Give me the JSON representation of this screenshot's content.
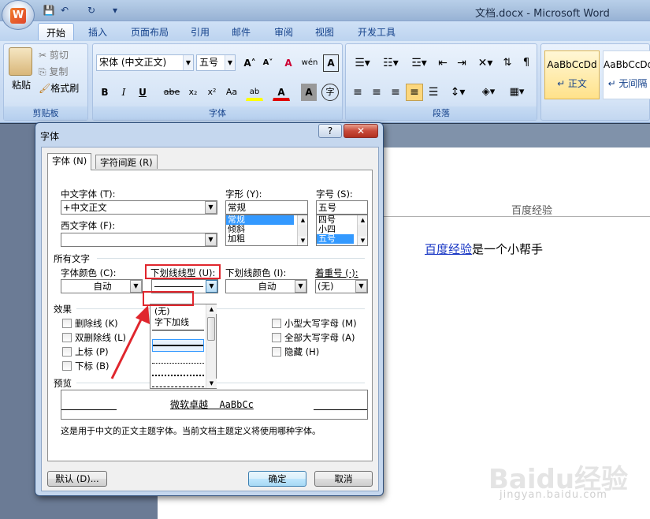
{
  "window": {
    "title": "文档.docx - Microsoft Word",
    "office_logo_letter": "W"
  },
  "qat": {
    "save": "💾",
    "undo": "↶",
    "redo": "↻",
    "more": "▾"
  },
  "ribbon_tabs": [
    "开始",
    "插入",
    "页面布局",
    "引用",
    "邮件",
    "审阅",
    "视图",
    "开发工具"
  ],
  "ribbon": {
    "clipboard": {
      "paste": "粘贴",
      "cut": "剪切",
      "copy": "复制",
      "format_painter": "格式刷",
      "label": "剪贴板"
    },
    "font": {
      "font_name": "宋体 (中文正文)",
      "font_size": "五号",
      "grow": "A˄",
      "shrink": "A˅",
      "clear": "A",
      "phonetic": "wén",
      "border": "A",
      "bold": "B",
      "italic": "I",
      "underline": "U",
      "strike": "abe",
      "sub": "x₂",
      "sup": "x²",
      "case": "Aa",
      "highlight": "ab",
      "color": "A",
      "shade": "A",
      "enclose": "字",
      "label": "字体"
    },
    "paragraph": {
      "label": "段落"
    },
    "styles": [
      {
        "sample": "AaBbCcDd",
        "name": "↵ 正文"
      },
      {
        "sample": "AaBbCcDd",
        "name": "↵ 无间隔"
      }
    ]
  },
  "document": {
    "header_text": "百度经验",
    "line_link": "百度经验",
    "line_rest": "是一个小帮手"
  },
  "dialog": {
    "title": "字体",
    "help": "?",
    "close": "✕",
    "tabs": [
      "字体 (N)",
      "字符间距 (R)"
    ],
    "cn_font_label": "中文字体 (T):",
    "cn_font_value": "+中文正文",
    "west_font_label": "西文字体 (F):",
    "west_font_value": "",
    "style_label": "字形 (Y):",
    "style_value": "常规",
    "style_options": [
      "常规",
      "倾斜",
      "加粗"
    ],
    "size_label": "字号 (S):",
    "size_value": "五号",
    "size_options": [
      "四号",
      "小四",
      "五号"
    ],
    "all_text_label": "所有文字",
    "font_color_label": "字体颜色 (C):",
    "font_color_value": "自动",
    "underline_type_label": "下划线线型 (U):",
    "underline_color_label": "下划线颜色 (I):",
    "underline_color_value": "自动",
    "emphasis_label": "着重号 (·):",
    "emphasis_value": "(无)",
    "effects_label": "效果",
    "effects_left": [
      "删除线 (K)",
      "双删除线 (L)",
      "上标 (P)",
      "下标 (B)"
    ],
    "effects_right": [
      "小型大写字母 (M)",
      "全部大写字母 (A)",
      "隐藏 (H)"
    ],
    "underline_options": [
      "(无)",
      "字下加线"
    ],
    "preview_label": "预览",
    "preview_text": "微软卓越  AaBbCc",
    "desc": "这是用于中文的正文主题字体。当前文档主题定义将使用哪种字体。",
    "default_btn": "默认 (D)...",
    "ok_btn": "确定",
    "cancel_btn": "取消"
  },
  "watermark": {
    "brand": "Baidu经验",
    "url": "jingyan.baidu.com"
  },
  "colors": {
    "accent": "#15428b",
    "red_marker": "#e0262d",
    "selection": "#3399ff"
  }
}
